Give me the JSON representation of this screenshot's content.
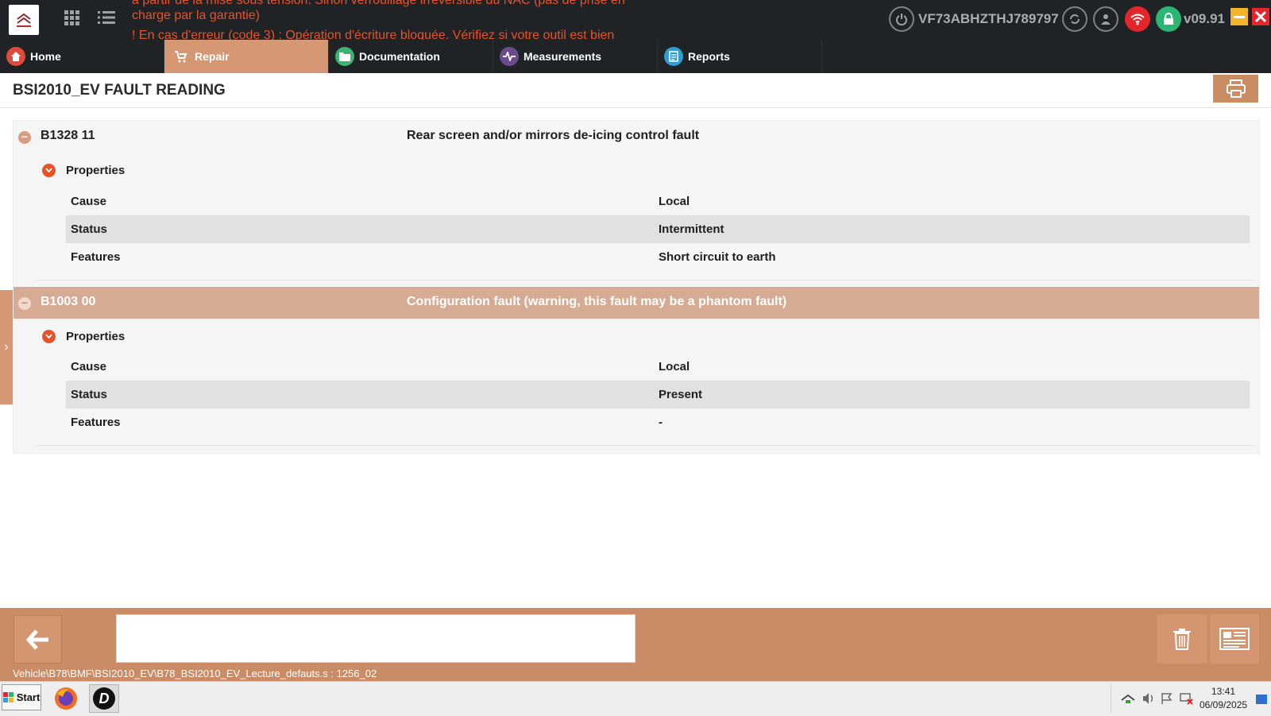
{
  "topbar": {
    "message_lines": [
      "à partir de la mise sous tension. Sinon verrouillage irréversible du NAC (pas de prise en",
      "charge par la garantie)",
      "! En cas d'erreur (code 3) : Opération d'écriture bloquée. Vérifiez si votre outil est bien"
    ],
    "vin": "VF73ABHZTHJ789797",
    "version": "v09.91"
  },
  "nav": {
    "tabs": [
      {
        "label": "Home",
        "icon": "home-icon",
        "color": "#e04a3a"
      },
      {
        "label": "Repair",
        "icon": "repair-icon",
        "color": "#d69774",
        "active": true
      },
      {
        "label": "Documentation",
        "icon": "folder-icon",
        "color": "#3cb371"
      },
      {
        "label": "Measurements",
        "icon": "waveform-icon",
        "color": "#6a4c8c"
      },
      {
        "label": "Reports",
        "icon": "report-icon",
        "color": "#2e9fd0"
      }
    ]
  },
  "page": {
    "title": "BSI2010_EV FAULT READING"
  },
  "faults": [
    {
      "code": "B1328 11",
      "description": "Rear screen and/or mirrors de-icing control fault",
      "properties_label": "Properties",
      "rows": [
        {
          "key": "Cause",
          "value": "Local"
        },
        {
          "key": "Status",
          "value": "Intermittent"
        },
        {
          "key": "Features",
          "value": "Short circuit to earth"
        }
      ]
    },
    {
      "code": "B1003 00",
      "description": "Configuration fault (warning, this fault may be a phantom fault)",
      "properties_label": "Properties",
      "selected": true,
      "rows": [
        {
          "key": "Cause",
          "value": "Local"
        },
        {
          "key": "Status",
          "value": "Present"
        },
        {
          "key": "Features",
          "value": "-"
        }
      ]
    }
  ],
  "bottom": {
    "path": "Vehicle\\B78\\BMF\\BSI2010_EV\\B78_BSI2010_EV_Lecture_defauts.s : 1256_02",
    "input_value": ""
  },
  "taskbar": {
    "start_label": "Start",
    "time": "13:41",
    "date": "06/09/2025"
  },
  "colors": {
    "accent": "#d69774",
    "bottom_bar": "#c98c66",
    "error_text": "#e8522a",
    "top_bar": "#1f2326"
  }
}
